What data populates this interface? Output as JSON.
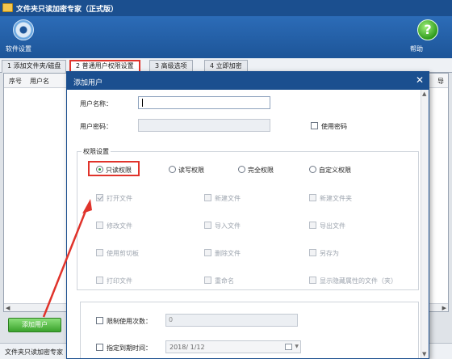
{
  "window": {
    "title": "文件夹只读加密专家（正式版）"
  },
  "toolbar": {
    "settings_label": "软件设置",
    "help_label": "帮助",
    "help_glyph": "?"
  },
  "tabs": [
    {
      "label": "1 添加文件夹/磁盘"
    },
    {
      "label": "2 普通用户权限设置"
    },
    {
      "label": "3 高级选项"
    },
    {
      "label": "4 立即加密"
    }
  ],
  "list": {
    "columns": [
      "序号",
      "用户名"
    ],
    "cut_column": "导"
  },
  "main": {
    "add_user_label": "添加用户"
  },
  "status": {
    "text": "文件夹只读加密专家"
  },
  "dialog": {
    "title": "添加用户",
    "close": "✕",
    "username_label": "用户名称：",
    "username_value": "",
    "password_label": "用户密码：",
    "use_password_label": "使用密码",
    "group_title": "权限设置",
    "radios": [
      {
        "label": "只读权限",
        "selected": true
      },
      {
        "label": "读写权限",
        "selected": false
      },
      {
        "label": "完全权限",
        "selected": false
      },
      {
        "label": "自定义权限",
        "selected": false
      }
    ],
    "permissions": [
      [
        "打开文件",
        "新建文件",
        "新建文件夹"
      ],
      [
        "修改文件",
        "导入文件",
        "导出文件"
      ],
      [
        "使用剪切板",
        "删除文件",
        "另存为"
      ],
      [
        "打印文件",
        "重命名",
        "显示隐藏属性的文件（夹）"
      ]
    ],
    "limit_uses_label": "限制使用次数：",
    "limit_uses_value": "0",
    "expire_label": "指定到期时间：",
    "expire_value": "2018/ 1/12"
  },
  "colors": {
    "title_blue": "#1b4f8f",
    "highlight_red": "#e0332b",
    "button_green": "#3aa22c"
  }
}
